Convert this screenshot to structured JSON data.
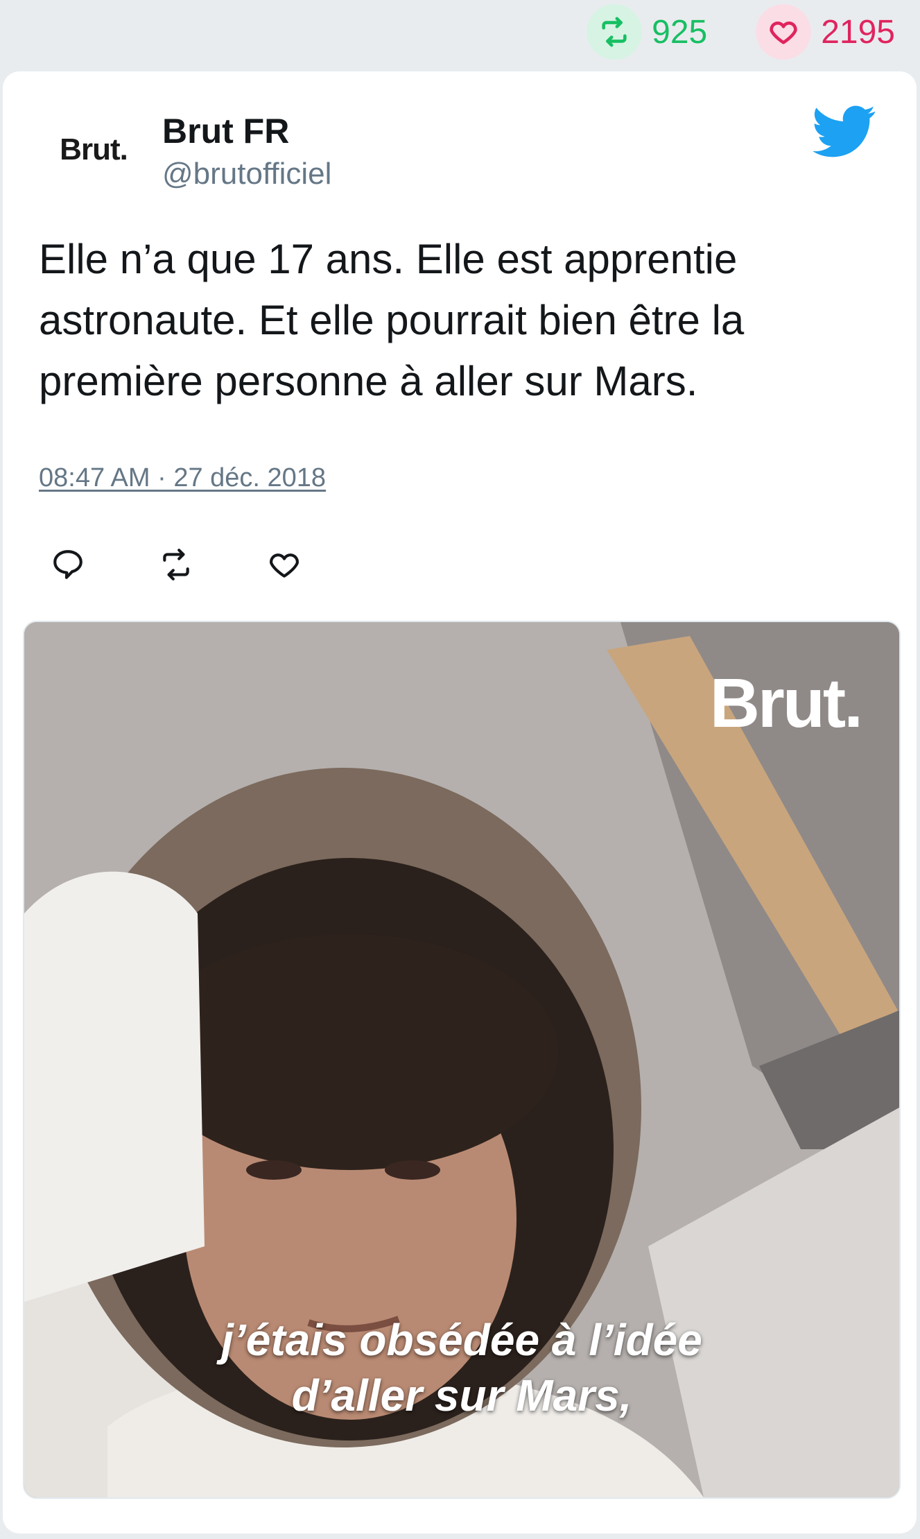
{
  "stats": {
    "retweets": "925",
    "likes": "2195",
    "retweet_color": "#17bf63",
    "like_color": "#e0245e"
  },
  "tweet": {
    "avatar_text": "Brut.",
    "name": "Brut FR",
    "handle": "@brutofficiel",
    "text": "Elle n’a que 17 ans. Elle est apprentie astronaute. Et elle pourrait bien être la première personne à aller sur Mars.",
    "timestamp": "08:47 AM · 27 déc. 2018",
    "icons": [
      "retweet-icon",
      "heart-icon",
      "twitter-bird-icon",
      "reply-icon"
    ]
  },
  "media": {
    "watermark": "Brut.",
    "caption_line1": "j’étais obsédée à l’idée",
    "caption_line2": "d’aller sur Mars,"
  },
  "colors": {
    "twitter_blue": "#1da1f2",
    "text_primary": "#14171a",
    "text_secondary": "#657786"
  }
}
